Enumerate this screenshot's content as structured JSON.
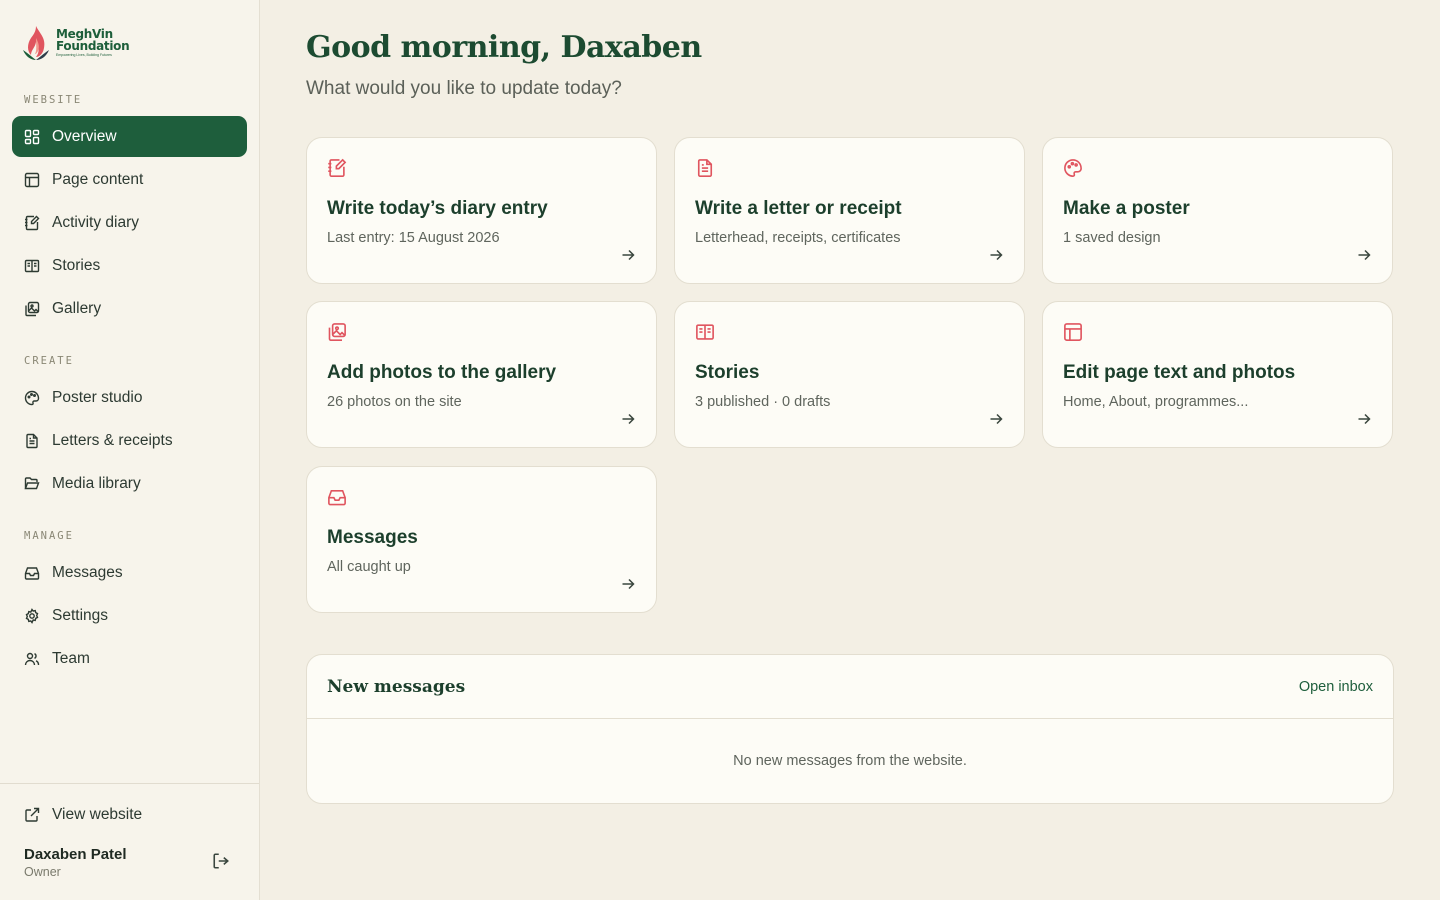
{
  "brand": {
    "name_line1": "MeghVin",
    "name_line2": "Foundation",
    "tagline": "Empowering Lives, Building Futures"
  },
  "sidebar": {
    "sections": [
      {
        "label": "WEBSITE"
      },
      {
        "label": "CREATE"
      },
      {
        "label": "MANAGE"
      }
    ],
    "items": [
      {
        "label": "Overview",
        "icon": "dashboard-icon",
        "active": true
      },
      {
        "label": "Page content",
        "icon": "layout-icon"
      },
      {
        "label": "Activity diary",
        "icon": "notebook-pen-icon"
      },
      {
        "label": "Stories",
        "icon": "book-open-icon"
      },
      {
        "label": "Gallery",
        "icon": "images-icon"
      },
      {
        "label": "Poster studio",
        "icon": "palette-icon"
      },
      {
        "label": "Letters & receipts",
        "icon": "file-text-icon"
      },
      {
        "label": "Media library",
        "icon": "folder-open-icon"
      },
      {
        "label": "Messages",
        "icon": "inbox-icon"
      },
      {
        "label": "Settings",
        "icon": "gear-icon"
      },
      {
        "label": "Team",
        "icon": "users-icon"
      }
    ],
    "view_website": "View website",
    "user": {
      "name": "Daxaben Patel",
      "role": "Owner"
    }
  },
  "main": {
    "greeting": "Good morning, Daxaben",
    "subtitle": "What would you like to update today?",
    "cards": [
      {
        "title": "Write today’s diary entry",
        "subtitle": "Last entry: 15 August 2026",
        "icon": "notebook-pen-icon"
      },
      {
        "title": "Write a letter or receipt",
        "subtitle": "Letterhead, receipts, certificates",
        "icon": "file-text-icon"
      },
      {
        "title": "Make a poster",
        "subtitle": "1 saved design",
        "icon": "palette-icon"
      },
      {
        "title": "Add photos to the gallery",
        "subtitle": "26 photos on the site",
        "icon": "images-icon"
      },
      {
        "title": "Stories",
        "subtitle": "3 published · 0 drafts",
        "icon": "book-open-icon"
      },
      {
        "title": "Edit page text and photos",
        "subtitle": "Home, About, programmes...",
        "icon": "layout-icon"
      },
      {
        "title": "Messages",
        "subtitle": "All caught up",
        "icon": "inbox-icon"
      }
    ],
    "messages_panel": {
      "title": "New messages",
      "link": "Open inbox",
      "empty_text": "No new messages from the website."
    }
  },
  "colors": {
    "accent": "#1e5e3c",
    "icon_accent": "#e0555f",
    "background": "#f3efe4",
    "card": "#fdfcf6"
  }
}
